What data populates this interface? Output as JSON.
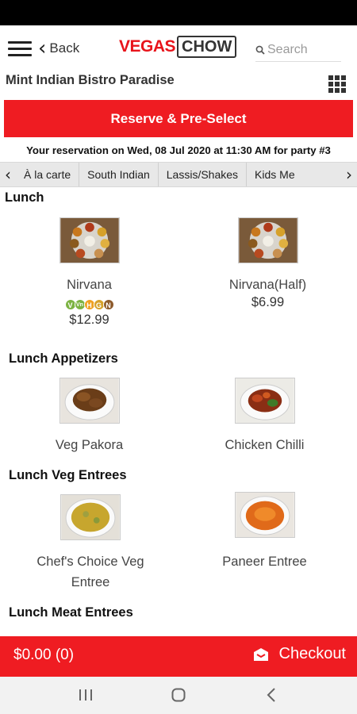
{
  "header": {
    "back_label": "Back",
    "logo_left": "VEGAS",
    "logo_right": "CHOW",
    "search_placeholder": "Search"
  },
  "restaurant": {
    "name": "Mint Indian Bistro Paradise"
  },
  "reserve_button": "Reserve & Pre-Select",
  "reservation_info": "Your reservation on Wed, 08 Jul 2020 at 11:30 AM for party #3",
  "tabs": [
    "À la carte",
    "South Indian",
    "Lassis/Shakes",
    "Kids Me"
  ],
  "sections": [
    {
      "title": "Lunch",
      "items": [
        {
          "name": "Nirvana",
          "price": "$12.99",
          "badges": [
            "V",
            "Vn",
            "H",
            "G",
            "N"
          ]
        },
        {
          "name": "Nirvana(Half)",
          "price": "$6.99"
        }
      ]
    },
    {
      "title": "Lunch Appetizers",
      "items": [
        {
          "name": "Veg Pakora"
        },
        {
          "name": "Chicken Chilli"
        }
      ]
    },
    {
      "title": "Lunch Veg Entrees",
      "items": [
        {
          "name": "Chef's Choice Veg Entree"
        },
        {
          "name": "Paneer Entree"
        }
      ]
    },
    {
      "title": "Lunch Meat Entrees",
      "items": []
    }
  ],
  "cart": {
    "total": "$0.00 (0)",
    "checkout_label": "Checkout"
  },
  "colors": {
    "brand_red": "#ef1c22",
    "badge_green": "#7cb342",
    "badge_orange": "#f0a020",
    "badge_brown": "#8d5a2b"
  }
}
